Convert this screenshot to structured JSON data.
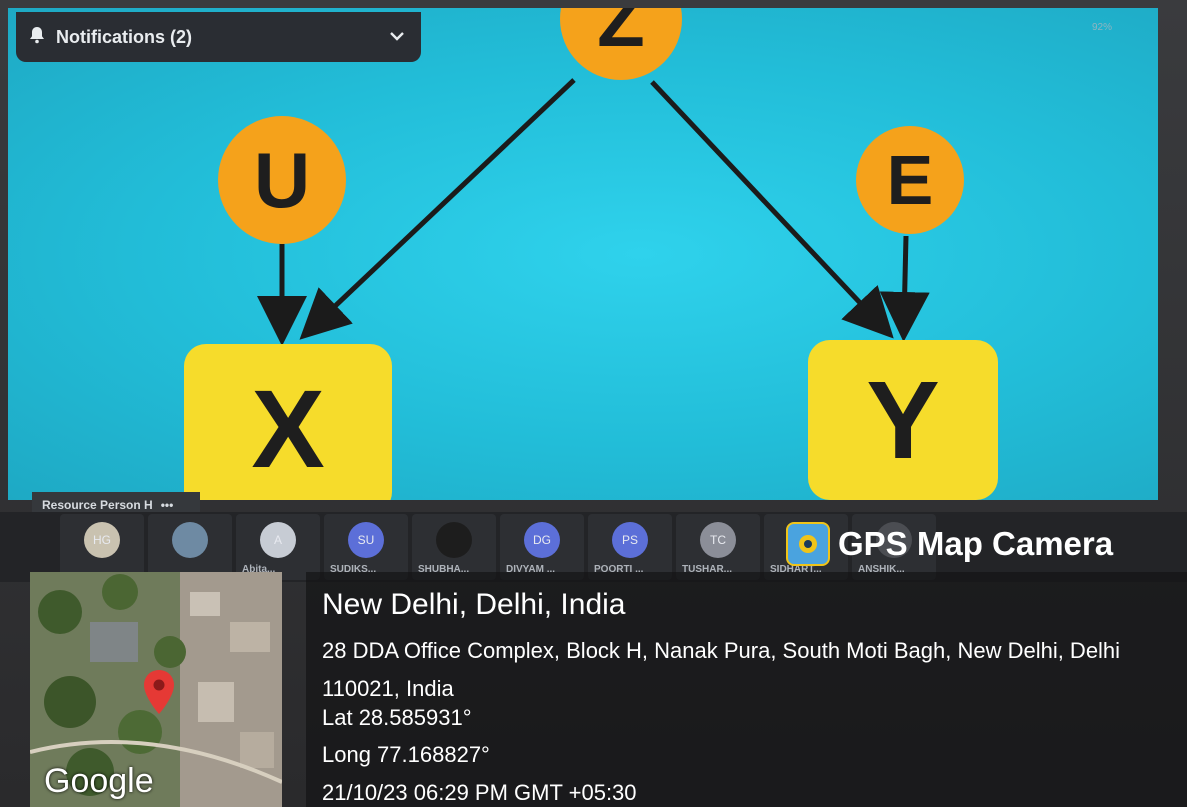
{
  "screen": {
    "notification_label": "Notifications (2)",
    "battery_text": "92%",
    "resource_person": "Resource Person H",
    "nodes": [
      "Z",
      "U",
      "E",
      "X",
      "Y"
    ]
  },
  "participants": [
    {
      "initials": "HG",
      "name": "",
      "color": "#c9c2b0"
    },
    {
      "initials": "",
      "name": "",
      "color": "#6e8aa3"
    },
    {
      "initials": "A",
      "name": "Abita...",
      "color": "#c7ccd4"
    },
    {
      "initials": "SU",
      "name": "SUDIKS...",
      "color": "#5c6fd8"
    },
    {
      "initials": "",
      "name": "SHUBHA...",
      "color": "#1d1d1d"
    },
    {
      "initials": "DG",
      "name": "DIVYAM ...",
      "color": "#5c6fd8"
    },
    {
      "initials": "PS",
      "name": "POORTI ...",
      "color": "#5c6fd8"
    },
    {
      "initials": "TC",
      "name": "TUSHAR...",
      "color": "#8b8e98"
    },
    {
      "initials": "",
      "name": "SIDHART...",
      "color": "#4b4d52"
    },
    {
      "initials": "",
      "name": "ANSHIK...",
      "color": "#4b4d52"
    }
  ],
  "gps": {
    "brand": "GPS Map Camera",
    "map_logo": "Google",
    "city": "New Delhi, Delhi, India",
    "address": "28 DDA Office Complex, Block H, Nanak Pura, South Moti Bagh, New Delhi, Delhi 110021, India",
    "lat": "Lat 28.585931°",
    "long": "Long 77.168827°",
    "datetime": "21/10/23 06:29 PM GMT +05:30"
  }
}
